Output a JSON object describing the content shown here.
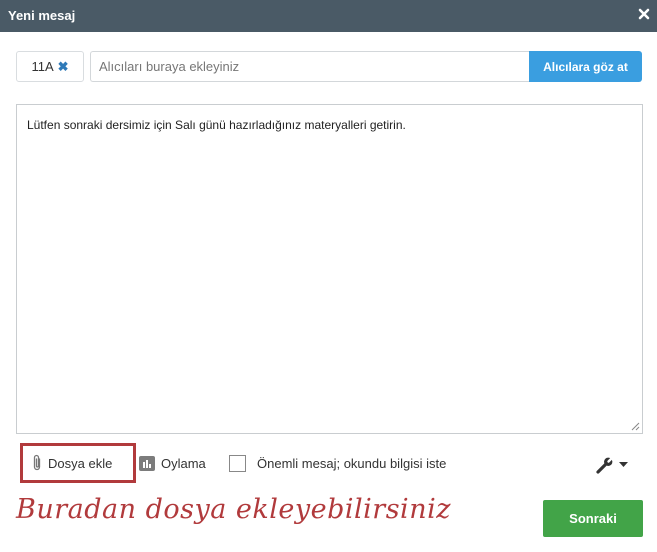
{
  "window": {
    "title": "Yeni mesaj",
    "close_icon": "close-icon"
  },
  "recipients": {
    "chips": [
      {
        "label": "11A",
        "remove_icon": "remove-icon"
      }
    ],
    "input_placeholder": "Alıcıları buraya ekleyiniz",
    "browse_label": "Alıcılara göz at"
  },
  "message": {
    "body": "Lütfen sonraki dersimiz için Salı günü hazırladığınız materyalleri getirin."
  },
  "toolbar": {
    "attach_label": "Dosya ekle",
    "attach_icon": "paperclip-icon",
    "poll_label": "Oylama",
    "poll_icon": "bar-chart-icon",
    "important_label": "Önemli mesaj; okundu bilgisi iste",
    "important_checked": false,
    "tools_icon": "wrench-icon"
  },
  "annotation": {
    "hint_text": "Buradan dosya ekleyebilirsiniz",
    "color": "#b13a3c"
  },
  "footer": {
    "next_label": "Sonraki"
  },
  "colors": {
    "titlebar": "#4a5a66",
    "browse_button": "#3a9ee0",
    "next_button": "#42a448",
    "accent": "#2f7ab8"
  }
}
